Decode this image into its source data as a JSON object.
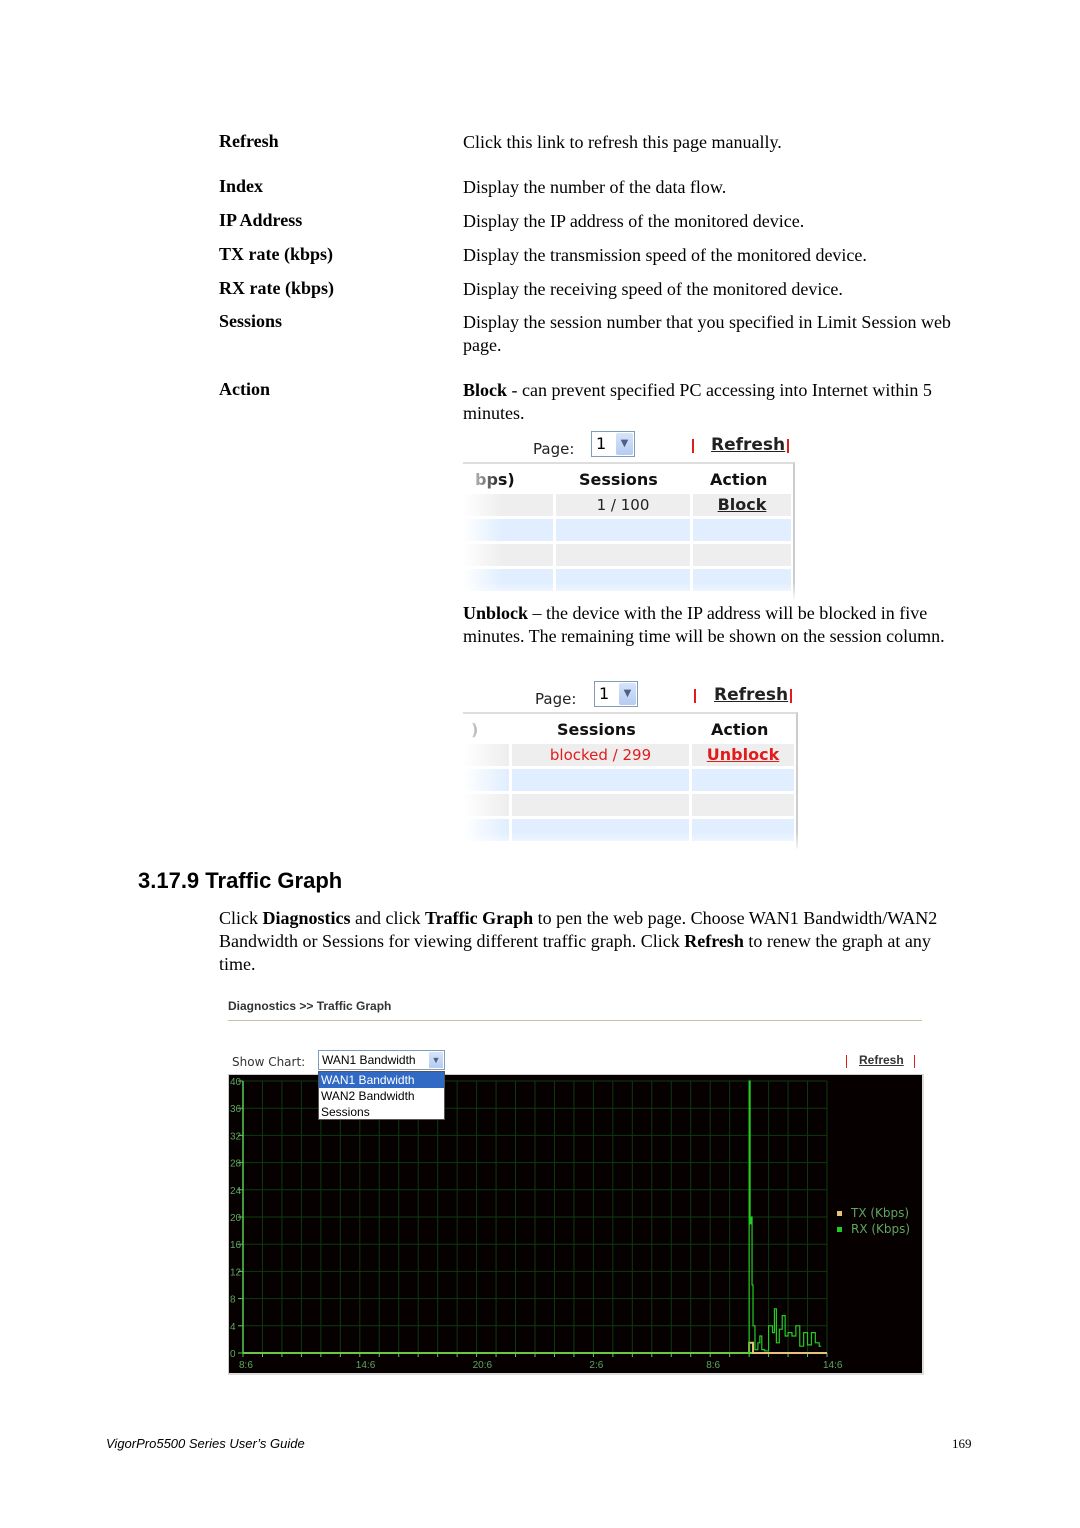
{
  "definitions": [
    {
      "term": "Refresh",
      "desc": "Click this link to refresh this page manually."
    },
    {
      "term": "Index",
      "desc": "Display the number of the data flow."
    },
    {
      "term": "IP Address",
      "desc": "Display the IP address of the monitored device."
    },
    {
      "term": "TX rate (kbps)",
      "desc": "Display the transmission speed of the monitored device."
    },
    {
      "term": "RX rate (kbps)",
      "desc": "Display the receiving speed of the monitored device."
    },
    {
      "term": "Sessions",
      "desc": "Display the session number that you specified in Limit Session web page."
    },
    {
      "term": "Action",
      "desc_bold": "Block",
      "desc": " - can prevent specified PC accessing into Internet within 5 minutes."
    }
  ],
  "unblock_desc": {
    "bold": "Unblock",
    "text": " – the device with the IP address will be blocked in five minutes. The remaining time will be shown on the session column."
  },
  "snippet_block": {
    "page_label": "Page:",
    "page_value": "1",
    "refresh": "Refresh",
    "col_partial": "bps)",
    "col_sessions": "Sessions",
    "col_action": "Action",
    "sessions_value": "1 / 100",
    "action_link": "Block"
  },
  "snippet_unblock": {
    "page_label": "Page:",
    "page_value": "1",
    "refresh": "Refresh",
    "col_partial": ")",
    "col_sessions": "Sessions",
    "col_action": "Action",
    "sessions_value": "blocked / 299",
    "action_link": "Unblock",
    "alert_color": "#e31b1b"
  },
  "section": {
    "heading": "3.17.9 Traffic Graph",
    "para_parts": [
      {
        "t": "Click ",
        "b": false
      },
      {
        "t": "Diagnostics",
        "b": true
      },
      {
        "t": " and click ",
        "b": false
      },
      {
        "t": "Traffic Graph",
        "b": true
      },
      {
        "t": " to pen the web page. Choose WAN1 Bandwidth/WAN2 Bandwidth or Sessions for viewing different traffic graph. Click ",
        "b": false
      },
      {
        "t": "Refresh",
        "b": true
      },
      {
        "t": " to renew the graph at any time.",
        "b": false
      }
    ]
  },
  "traffic_graph": {
    "breadcrumb": "Diagnostics >> Traffic Graph",
    "show_chart_label": "Show Chart:",
    "selected": "WAN1 Bandwidth",
    "options": [
      "WAN1 Bandwidth",
      "WAN2 Bandwidth",
      "Sessions"
    ],
    "refresh": "Refresh"
  },
  "chart_data": {
    "type": "line",
    "title": "",
    "xlabel": "",
    "ylabel": "",
    "ylim": [
      0,
      40
    ],
    "yticks": [
      "0",
      "4",
      "8",
      "12",
      "16",
      "20",
      "24",
      "28",
      "32",
      "36",
      "40"
    ],
    "xticks": [
      "8:6",
      "14:6",
      "20:6",
      "2:6",
      "8:6",
      "14:6"
    ],
    "x_range_hours": [
      0,
      30
    ],
    "grid": true,
    "legend_position": "right",
    "colors": {
      "tx": "#e8c27a",
      "rx": "#22cc22",
      "grid": "#0d3a0d",
      "axis": "#55cc55",
      "text": "#5fa55f"
    },
    "series": [
      {
        "name": "TX (Kbps)",
        "x": [
          0,
          25.9,
          26.0,
          26.1,
          26.2,
          26.6,
          30
        ],
        "y": [
          0,
          0,
          1.5,
          1.5,
          0,
          0,
          0
        ]
      },
      {
        "name": "RX (Kbps)",
        "x": [
          0,
          25.95,
          26.0,
          26.05,
          26.1,
          26.15,
          26.2,
          26.3,
          26.45,
          26.55,
          26.65,
          26.8,
          27.0,
          27.2,
          27.3,
          27.4,
          27.55,
          27.7,
          27.85,
          28.0,
          28.2,
          28.4,
          28.6,
          28.8,
          29.0,
          29.2,
          29.4,
          29.6,
          29.7
        ],
        "y": [
          0,
          0,
          40,
          19,
          20,
          10,
          4,
          0.5,
          1.5,
          2.5,
          0.5,
          0.3,
          4,
          3,
          6.5,
          1.5,
          3.5,
          5.5,
          2.5,
          3,
          2.5,
          4,
          1,
          3,
          1.2,
          3,
          1.5,
          1,
          1
        ]
      }
    ]
  },
  "footer": {
    "left": "VigorPro5500 Series User’s Guide",
    "page": "169"
  }
}
